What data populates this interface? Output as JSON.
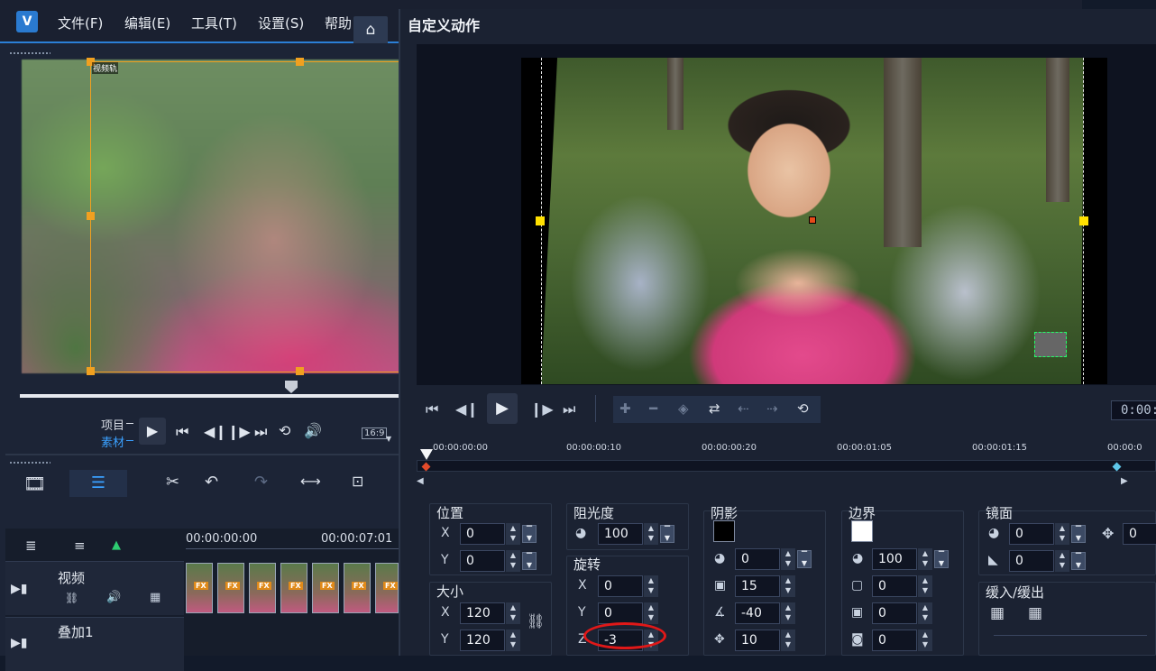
{
  "app": {
    "logo_text": "V",
    "menu": [
      "文件(F)",
      "编辑(E)",
      "工具(T)",
      "设置(S)",
      "帮助"
    ],
    "home_icon": "home-icon",
    "preview": {
      "track_tag": "视频轨",
      "mode_project": "项目",
      "mode_clip": "素材",
      "aspect_ratio": "16:9",
      "accent_color": "#f0a020"
    },
    "timeline": {
      "start_time": "00:00:00:00",
      "mark_time": "00:00:07:01",
      "tracks": [
        {
          "name": "视频"
        },
        {
          "name": "叠加1"
        }
      ],
      "fx_label": "FX"
    }
  },
  "dialog": {
    "title": "自定义动作",
    "timecode": "0:00:",
    "ruler": [
      "00:00:00:00",
      "00:00:00:10",
      "00:00:00:20",
      "00:00:01:05",
      "00:00:01:15",
      "00:00:0"
    ],
    "position": {
      "label": "位置",
      "x_label": "X",
      "x": "0",
      "y_label": "Y",
      "y": "0"
    },
    "size": {
      "label": "大小",
      "x_label": "X",
      "x": "120",
      "y_label": "Y",
      "y": "120"
    },
    "opacity": {
      "label": "阻光度",
      "value": "100"
    },
    "rotation": {
      "label": "旋转",
      "x_label": "X",
      "x": "0",
      "y_label": "Y",
      "y": "0",
      "z_label": "Z",
      "z": "-3"
    },
    "shadow": {
      "label": "阴影",
      "color": "#000000",
      "opacity": "0",
      "blur": "15",
      "angle": "-40",
      "distance": "10"
    },
    "border": {
      "label": "边界",
      "color": "#ffffff",
      "opacity": "100",
      "width": "0",
      "v2": "0",
      "v3": "0"
    },
    "mirror": {
      "label": "镜面",
      "opacity": "0",
      "distance": "0",
      "offset": "0"
    },
    "ease": {
      "label": "缓入/缓出"
    }
  }
}
